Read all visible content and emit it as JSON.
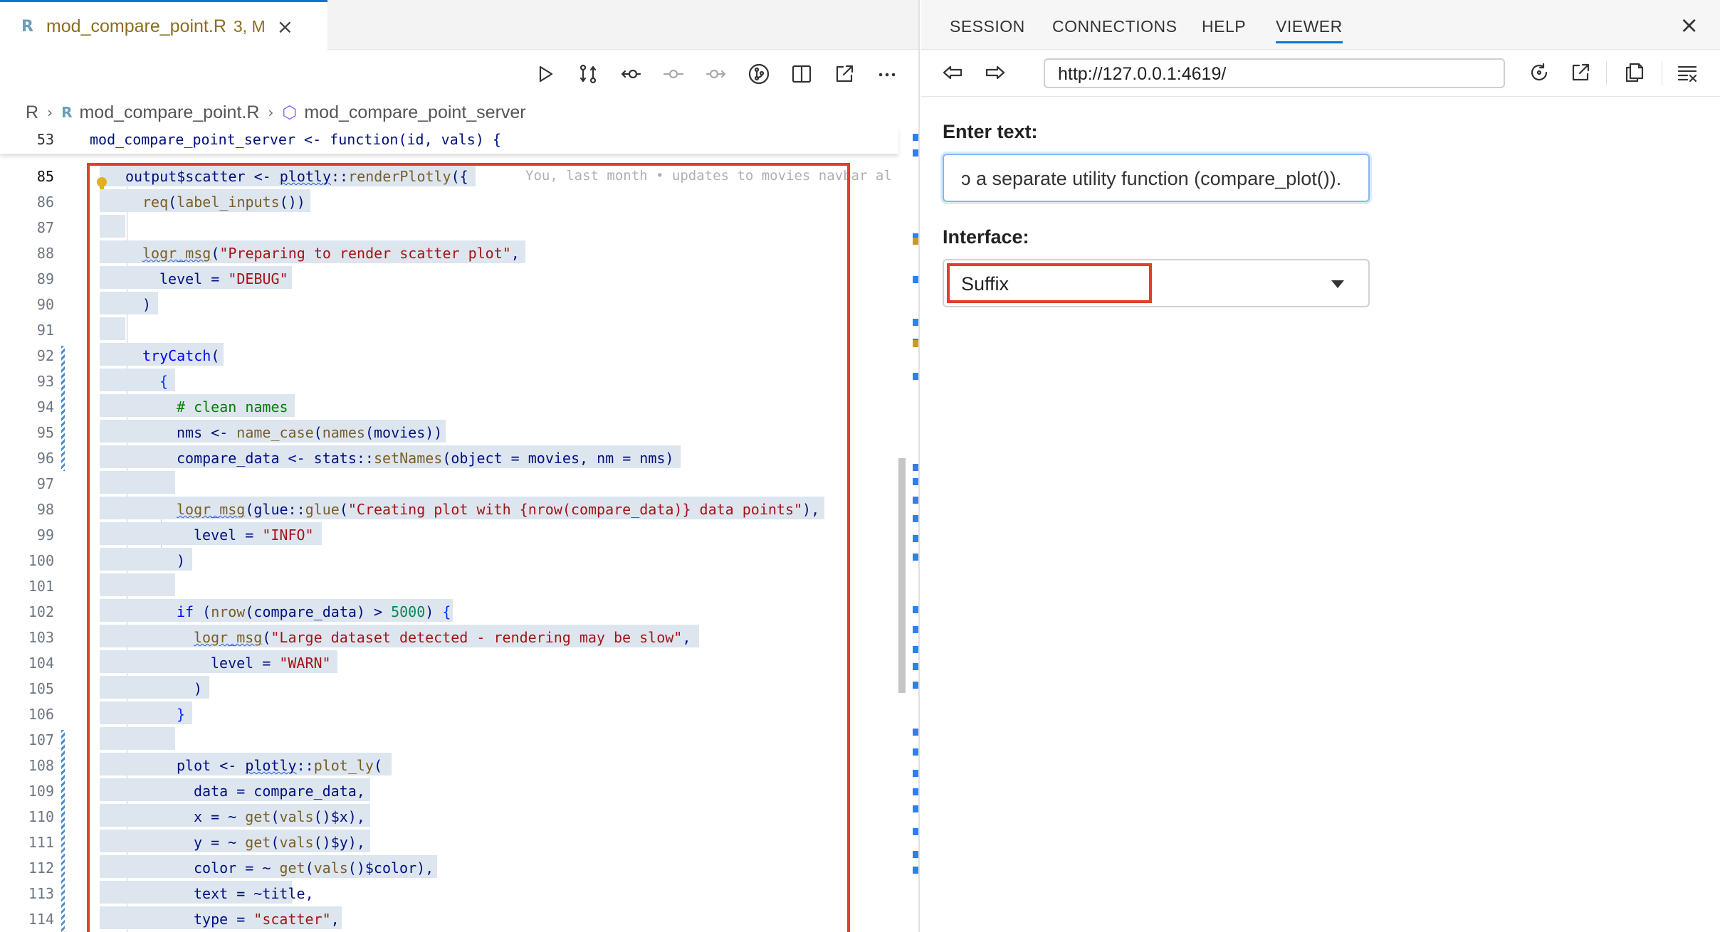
{
  "editor": {
    "tab": {
      "icon": "r-file-icon",
      "filename": "mod_compare_point.R",
      "status": "3, M",
      "close": "×"
    },
    "breadcrumb": {
      "root": "R",
      "file": "mod_compare_point.R",
      "symbol": "mod_compare_point_server",
      "sep": "›"
    },
    "sticky": {
      "line": "53",
      "text": "mod_compare_point_server <- function(id, vals) {"
    },
    "blame": "You, last month • updates to movies navbar al",
    "line_numbers": [
      "85",
      "86",
      "87",
      "88",
      "89",
      "90",
      "91",
      "92",
      "93",
      "94",
      "95",
      "96",
      "97",
      "98",
      "99",
      "100",
      "101",
      "102",
      "103",
      "104",
      "105",
      "106",
      "107",
      "108",
      "109",
      "110",
      "111",
      "112",
      "113",
      "114"
    ],
    "toolbar": [
      "run-icon",
      "compare-changes-icon",
      "go-back-icon",
      "go-to-current-icon",
      "go-forward-icon",
      "git-graph-icon",
      "split-editor-icon",
      "open-external-icon",
      "more-actions-icon"
    ]
  },
  "viewer": {
    "tabs": [
      "SESSION",
      "CONNECTIONS",
      "HELP",
      "VIEWER"
    ],
    "active_tab": "VIEWER",
    "close": "×",
    "url": "http://127.0.0.1:4619/",
    "app": {
      "text_label": "Enter text:",
      "text_value": "ↄ a separate utility function (compare_plot()).",
      "select_label": "Interface:",
      "select_value": "Suffix"
    }
  },
  "colors": {
    "accent": "#0078d4",
    "highlight_box": "#e0402a",
    "selection": "#dde5ef"
  }
}
